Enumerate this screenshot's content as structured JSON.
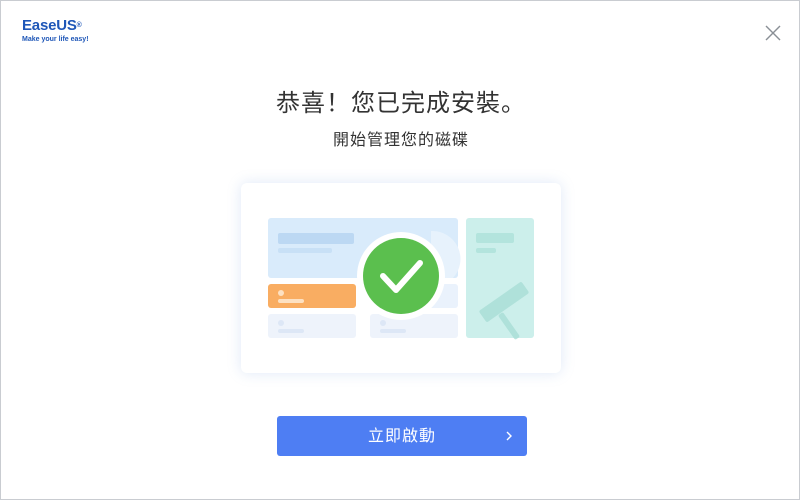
{
  "logo": {
    "brand_ease": "Ease",
    "brand_us": "US",
    "registered": "®",
    "tagline": "Make your life easy!"
  },
  "header": {
    "close_icon": "close-icon"
  },
  "main": {
    "title": "恭喜！您已完成安裝。",
    "subtitle": "開始管理您的磁碟",
    "illustration_icon": "check-circle-icon"
  },
  "launch_button": {
    "label": "立即啟動",
    "icon": "chevron-right-icon"
  },
  "colors": {
    "accent": "#4e7ef3",
    "success": "#5bbf4e",
    "brand": "#1f57b8",
    "highlight": "#f8a85c"
  }
}
